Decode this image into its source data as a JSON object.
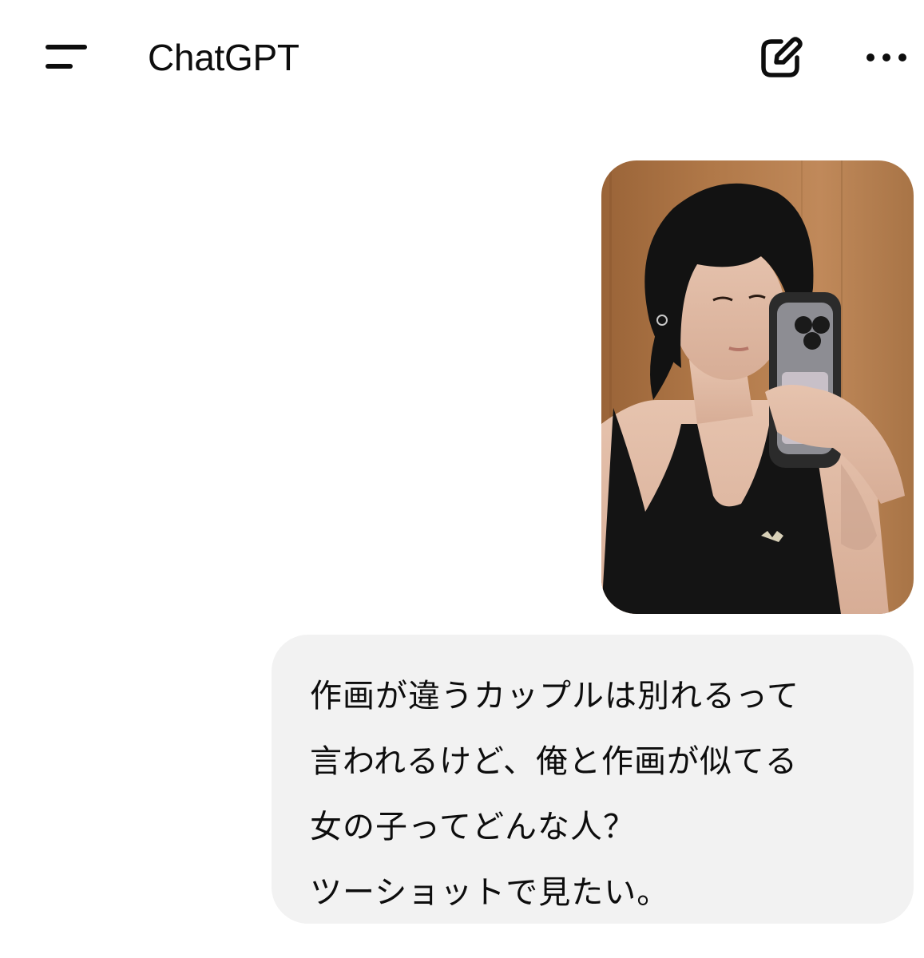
{
  "header": {
    "title": "ChatGPT",
    "menu_icon": "sidebar-menu-icon",
    "new_chat_icon": "pencil-square-icon",
    "more_icon": "ellipsis-icon"
  },
  "conversation": {
    "user_message": {
      "image_alt": "mirror selfie photo",
      "lines": [
        "作画が違うカップルは別れるって",
        "言われるけど、俺と作画が似てる",
        "女の子ってどんな人？",
        "ツーショットで見たい。"
      ]
    }
  },
  "colors": {
    "bubble_bg": "#f2f2f2",
    "text": "#0d0d0d",
    "background": "#ffffff"
  }
}
